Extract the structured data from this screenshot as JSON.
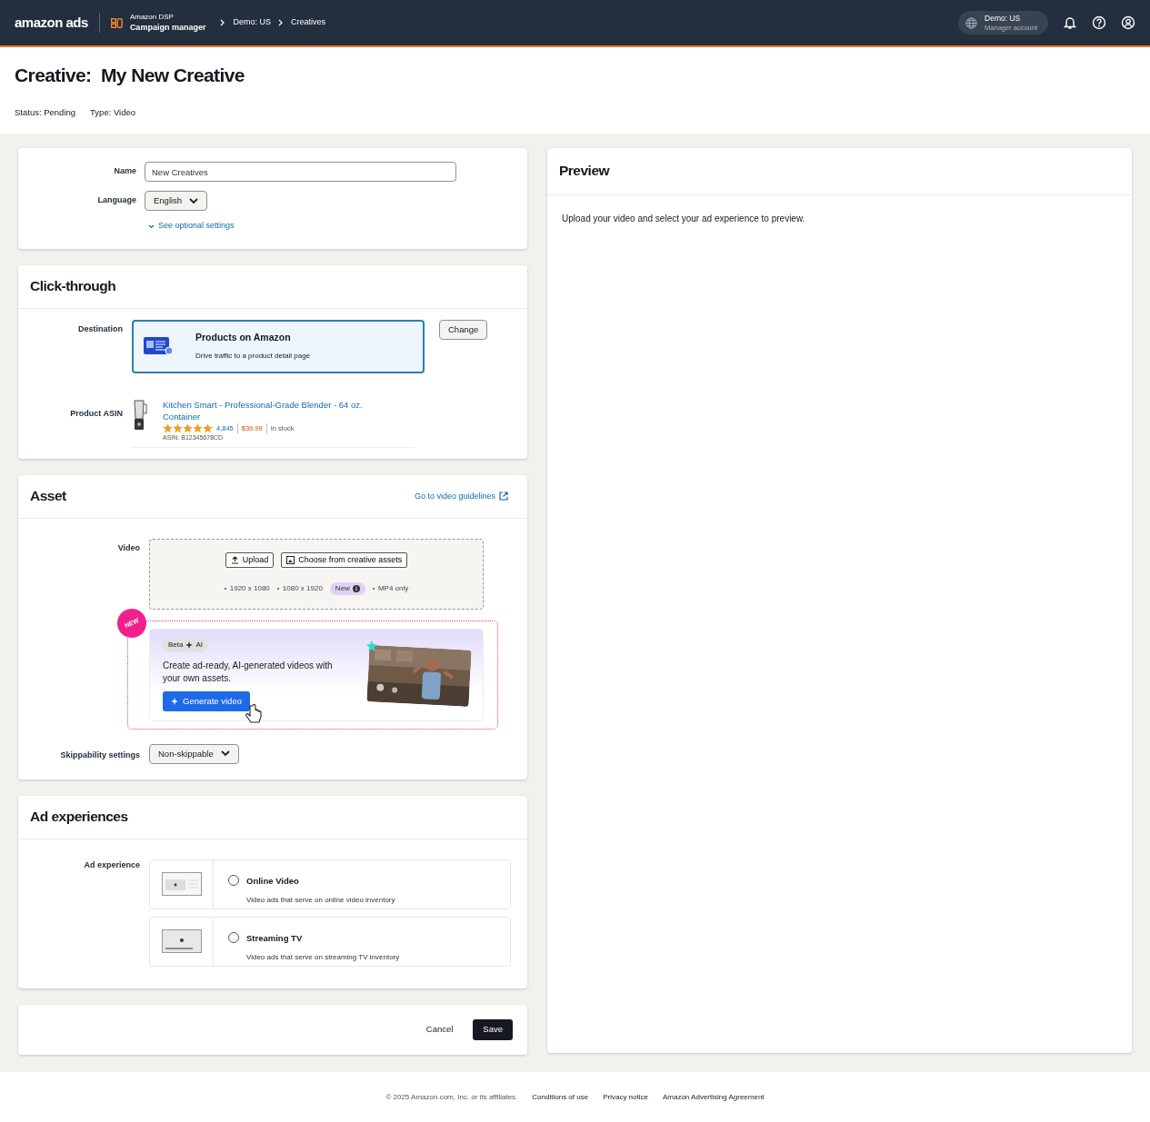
{
  "header": {
    "logo": "amazon ads",
    "product": "Amazon DSP",
    "app": "Campaign manager",
    "breadcrumbs": [
      "Demo: US",
      "Creatives"
    ],
    "account": {
      "name": "Demo: US",
      "role": "Manager account"
    }
  },
  "page": {
    "title_label": "Creative:",
    "title": "My New Creative",
    "meta": [
      {
        "label": "Status:",
        "value": "Pending"
      },
      {
        "label": "Type:",
        "value": "Video"
      }
    ]
  },
  "general": {
    "name": {
      "label": "Name",
      "value": "New Creatives"
    },
    "language": {
      "label": "Language",
      "value": "English"
    },
    "optional_link": "See optional settings"
  },
  "click_through": {
    "title": "Click-through",
    "destination_label": "Destination",
    "destination": {
      "title": "Products on Amazon",
      "description": "Drive traffic to a product detail page",
      "selected": true
    },
    "change_button": "Change",
    "asin_label": "Product ASIN",
    "product": {
      "name": "Kitchen Smart - Professional-Grade Blender - 64 oz. Container",
      "stars": 5,
      "reviews": "4,845",
      "price": "$39.99",
      "availability": "In stock",
      "asin": "ASIN: B12345678CD"
    }
  },
  "asset": {
    "title": "Asset",
    "guidelines_link": "Go to video guidelines",
    "video_label": "Video",
    "buttons": [
      {
        "kind": "upload",
        "label": "Upload"
      },
      {
        "kind": "library",
        "label": "Choose from creative assets"
      }
    ],
    "specs": [
      {
        "text": "1920 x 1080"
      },
      {
        "text": "1080 x 1920",
        "badge": "New"
      },
      {
        "text": "MP4 only"
      }
    ],
    "ai_promo": {
      "corner_badge": "NEW",
      "tag": "Beta",
      "tag_ai": "AI",
      "text": "Create ad-ready, AI-generated videos with your own assets.",
      "button": "Generate video"
    },
    "skippability": {
      "label": "Skippability settings",
      "value": "Non-skippable"
    }
  },
  "ad_experiences": {
    "title": "Ad experiences",
    "label": "Ad experience",
    "options": [
      {
        "kind": "online",
        "title": "Online Video",
        "description": "Video ads that serve on online video inventory",
        "selected": false
      },
      {
        "kind": "tv",
        "title": "Streaming TV",
        "description": "Video ads that serve on streaming TV inventory",
        "selected": false
      }
    ]
  },
  "actions": {
    "cancel": "Cancel",
    "save": "Save"
  },
  "preview": {
    "title": "Preview",
    "message": "Upload your video and select your ad experience to preview."
  },
  "footer": {
    "copyright": "© 2025 Amazon.com, Inc. or its affiliates.",
    "links": [
      "Conditions of use",
      "Privacy notice",
      "Amazon Advertising Agreement"
    ]
  }
}
